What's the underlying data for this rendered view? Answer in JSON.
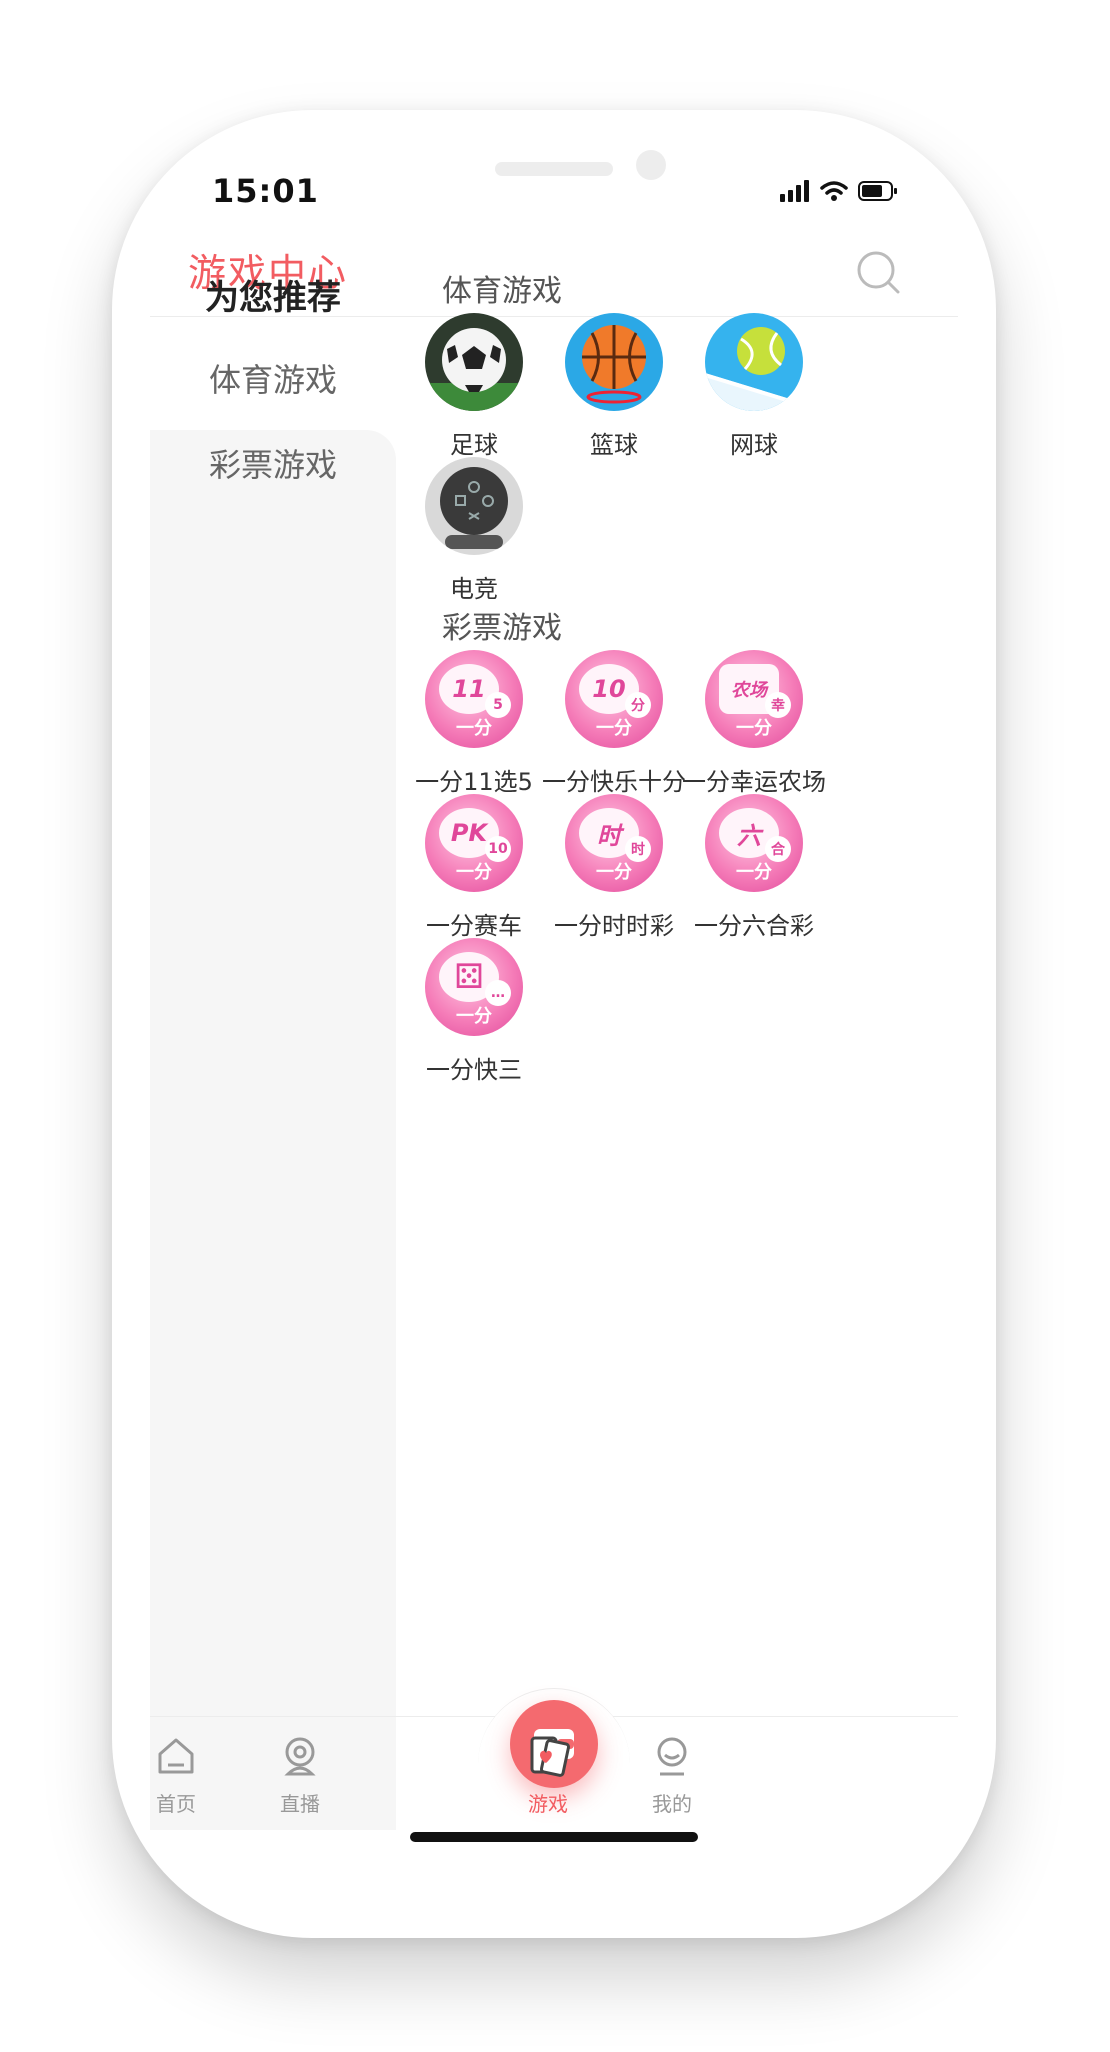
{
  "status": {
    "time": "15:01"
  },
  "header": {
    "title": "游戏中心"
  },
  "sidebar": {
    "items": [
      {
        "label": "为您推荐"
      },
      {
        "label": "体育游戏"
      },
      {
        "label": "彩票游戏"
      }
    ]
  },
  "sections": [
    {
      "title": "体育游戏",
      "games": [
        {
          "label": "足球",
          "icon": "soccer-ball-icon"
        },
        {
          "label": "篮球",
          "icon": "basketball-icon"
        },
        {
          "label": "网球",
          "icon": "tennis-ball-icon"
        },
        {
          "label": "电竞",
          "icon": "gamepad-icon"
        }
      ]
    },
    {
      "title": "彩票游戏",
      "games": [
        {
          "label": "一分11选5",
          "icon": "lottery-11x5-icon",
          "badge": "11",
          "mini": "5"
        },
        {
          "label": "一分快乐十分",
          "icon": "lottery-happy10-icon",
          "badge": "10",
          "mini": "分"
        },
        {
          "label": "一分幸运农场",
          "icon": "lottery-farm-icon",
          "badge": "农场",
          "mini": "幸"
        },
        {
          "label": "一分赛车",
          "icon": "lottery-pk10-icon",
          "badge": "PK",
          "mini": "10"
        },
        {
          "label": "一分时时彩",
          "icon": "lottery-ssc-icon",
          "badge": "时",
          "mini": "时"
        },
        {
          "label": "一分六合彩",
          "icon": "lottery-lhc-icon",
          "badge": "六",
          "mini": "合"
        },
        {
          "label": "一分快三",
          "icon": "lottery-k3-icon",
          "badge": "⚄",
          "mini": "…"
        }
      ]
    }
  ],
  "lottery_sub": "一分",
  "tabbar": {
    "items": [
      {
        "label": "首页"
      },
      {
        "label": "直播"
      },
      {
        "label": "游戏"
      },
      {
        "label": "我的"
      }
    ],
    "active": "游戏"
  },
  "colors": {
    "accent": "#f25c61",
    "lottery_pink": "#e0479a",
    "sidebar_bg": "#f6f6f6"
  }
}
